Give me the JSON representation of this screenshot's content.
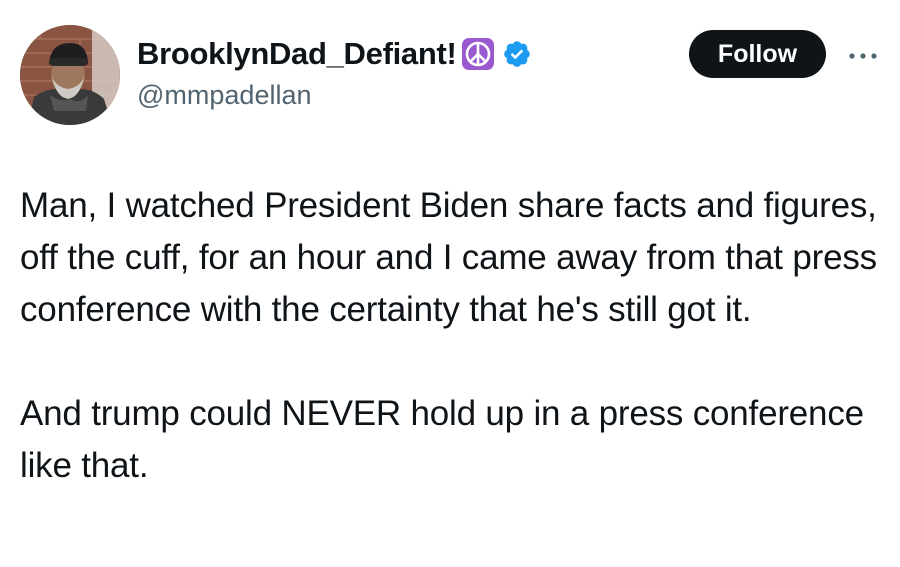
{
  "author": {
    "display_name": "BrooklynDad_Defiant!",
    "emoji_icon": "peace-symbol-icon",
    "badge_icon": "verified-badge-icon",
    "handle": "@mmpadellan",
    "badge_color": "#1d9bf0",
    "emoji_color": "#9b59d0"
  },
  "actions": {
    "follow_label": "Follow",
    "more_icon": "more-options-icon"
  },
  "tweet": {
    "paragraph_1": "Man, I watched President Biden share facts and figures, off the cuff, for an hour and I came away from that press conference with the certainty that he's still got it.",
    "paragraph_2": "And trump could NEVER hold up in a press conference like that."
  }
}
